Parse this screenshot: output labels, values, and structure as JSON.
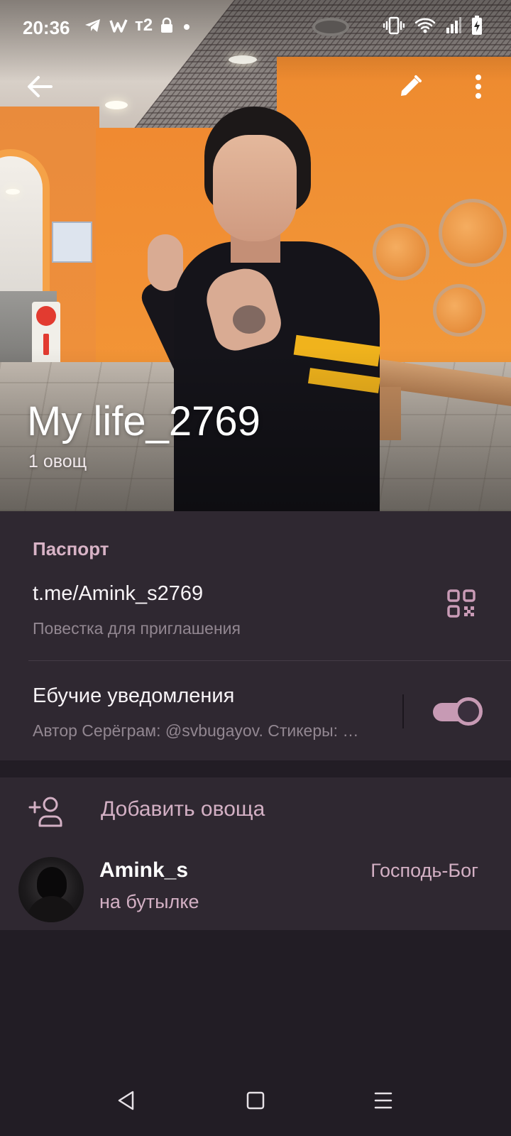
{
  "status_bar": {
    "time": "20:36",
    "carrier_label": "т2",
    "icons": [
      "telegram-icon",
      "w-app-icon",
      "lock-icon",
      "dot-icon",
      "vibrate-icon",
      "wifi-icon",
      "signal-icon",
      "battery-charging-icon"
    ]
  },
  "header": {
    "title": "My life_2769",
    "subtitle": "1 овощ",
    "actions": [
      "back-arrow-icon",
      "pencil-icon",
      "more-vertical-icon"
    ]
  },
  "info": {
    "section_title": "Паспорт",
    "link": "t.me/Amink_s2769",
    "link_caption": "Повестка для приглашения",
    "notifications_title": "Ебучие уведомления",
    "notifications_subtitle": "Автор Серёграм: @svbugayov. Стикеры: …",
    "notifications_enabled": true
  },
  "members": {
    "add_label": "Добавить овоща",
    "list": [
      {
        "name": "Amink_s",
        "status": "на бутылке",
        "role": "Господь-Бог"
      }
    ]
  },
  "nav_bar": {
    "buttons": [
      "nav-back-icon",
      "nav-home-icon",
      "nav-menu-icon"
    ]
  },
  "colors": {
    "background": "#221d25",
    "card": "#2f2831",
    "accent": "#d3b0c4",
    "section_header": "#d8b3c6",
    "secondary_text": "#928791",
    "toggle_on": "#c79ab4"
  }
}
